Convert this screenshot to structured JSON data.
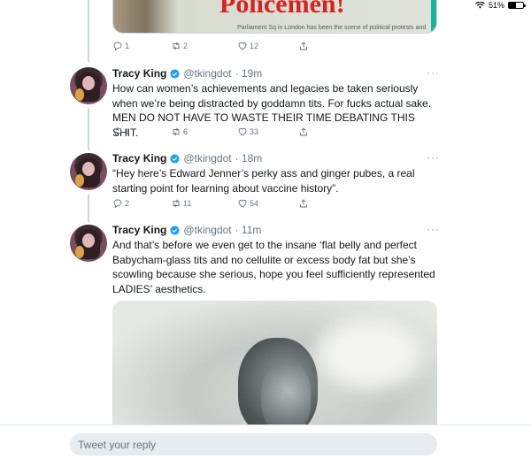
{
  "status_bar": {
    "battery_label": "51%",
    "battery_level": 0.51,
    "wifi_icon": "wifi-icon"
  },
  "previous_tweet": {
    "media_title": "Policemen!",
    "media_caption": "Parliament Sq in London has been the scene of political protests and",
    "replies": "1",
    "retweets": "2",
    "likes": "12"
  },
  "tweets": [
    {
      "name": "Tracy King",
      "handle": "@tkingdot",
      "time": "· 19m",
      "text": "How can women’s achievements and legacies be taken seriously when we’re being distracted by goddamn tits. For fucks actual sake. MEN DO NOT HAVE TO WASTE THEIR TIME DEBATING THIS SHIT.",
      "replies": "1",
      "retweets": "6",
      "likes": "33"
    },
    {
      "name": "Tracy King",
      "handle": "@tkingdot",
      "time": "· 18m",
      "text": "“Hey here’s Edward Jenner’s perky ass and ginger pubes, a real starting point for learning about vaccine history”.",
      "replies": "2",
      "retweets": "11",
      "likes": "54"
    },
    {
      "name": "Tracy King",
      "handle": "@tkingdot",
      "time": "· 11m",
      "text": "And that’s before we even get to the insane ‘flat belly and perfect Babycham-glass tits and no cellulite or excess body fat but she’s scowling because she serious, hope you feel sufficiently represented LADIES’ aesthetics."
    }
  ],
  "more_label": "···",
  "reply": {
    "placeholder": "Tweet your reply"
  },
  "colors": {
    "accent": "#1da1f2",
    "icon_gray": "#657786",
    "thread_line": "#ccd6dd"
  }
}
